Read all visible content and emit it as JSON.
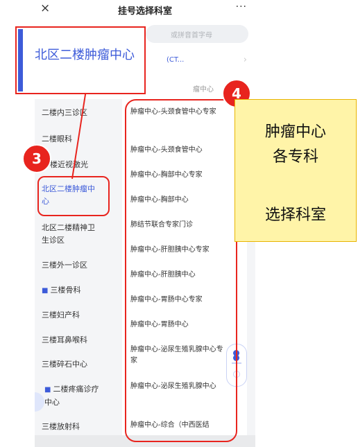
{
  "window": {
    "title": "挂号选择科室",
    "close_glyph": "×",
    "more_glyph": "···"
  },
  "search": {
    "placeholder": "或拼音首字母"
  },
  "selected": {
    "text": "(CT...",
    "arrow": "›"
  },
  "group_label": "瘤中心",
  "left_nav": [
    "二楼内三诊区",
    "二楼眼科",
    "楼近视激光",
    "北区二楼肿瘤中心",
    "北区二楼精神卫生诊区",
    "三楼外一诊区",
    "三楼骨科",
    "三楼妇产科",
    "三楼耳鼻喉科",
    "三楼碎石中心",
    "二楼疼痛诊疗中心",
    "三楼放射科"
  ],
  "right_list": [
    "肿瘤中心-头颈食管中心专家",
    "肿瘤中心-头颈食管中心",
    "肿瘤中心-胸部中心专家",
    "肿瘤中心-胸部中心",
    "肺结节联合专家门诊",
    "肿瘤中心-肝胆胰中心专家",
    "肿瘤中心-肝胆胰中心",
    "肿瘤中心-胃肠中心专家",
    "肿瘤中心-胃肠中心",
    "肿瘤中心-泌尿生殖乳腺中心专家",
    "肿瘤中心-泌尿生殖乳腺中心",
    "肿瘤中心-综合（中西医结"
  ],
  "callout": {
    "text": "北区二楼肿瘤中心"
  },
  "badges": {
    "b3": "3",
    "b4": "4"
  },
  "note": {
    "line1": "肿瘤中心",
    "line2": "各专科",
    "line3": "选择科室"
  },
  "colors": {
    "accent": "#3d5bd9",
    "highlight": "#e8241e",
    "note_bg": "#fff4a8"
  }
}
